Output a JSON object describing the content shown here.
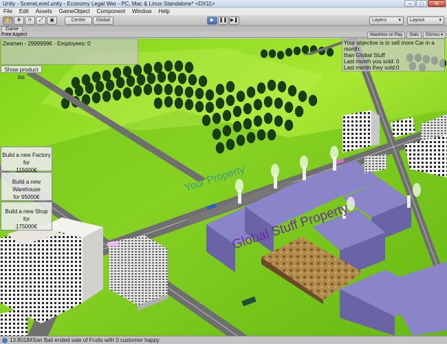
{
  "window": {
    "title": "Unity - SceneLevel.unity - Economy Legal War - PC, Mac & Linux Standalone* <DX11>",
    "min": "–",
    "max": "□",
    "close": "✕"
  },
  "menu": [
    "File",
    "Edit",
    "Assets",
    "GameObject",
    "Component",
    "Window",
    "Help"
  ],
  "toolbar": {
    "tools": [
      "hand-icon",
      "move-icon",
      "rotate-icon",
      "scale-icon",
      "rect-icon"
    ],
    "pivot": "Center",
    "space": "Global",
    "play": "▶",
    "pause": "❚❚",
    "step": "▶❚",
    "layers": "Layers",
    "layout": "Layout"
  },
  "game_tab": {
    "label": "Game",
    "aspect": "Free Aspect",
    "maximize": "Maximize on Play",
    "stats": "Stats",
    "gizmos": "Gizmos ▾"
  },
  "hud": {
    "company": "Zeomen - 2999999€ - Employees: 0",
    "show_products": "Show product list",
    "objective": [
      "Your objective is to sell more Car in a month",
      "than Global Stuff",
      "Last month you sold: 0",
      "Last month they sold:0"
    ]
  },
  "build_buttons": [
    {
      "line1": "Build a new Factory for",
      "line2": "115000€"
    },
    {
      "line1": "Build a new Warehouse",
      "line2": "for 95000€"
    },
    {
      "line1": "Build a new Shop for",
      "line2": "175000€"
    }
  ],
  "world_labels": {
    "your_property": "Your Property",
    "global_property": "Global Stuff Property"
  },
  "status": "13.80184San Bali ended sale of Fruits with 0 customer happy"
}
